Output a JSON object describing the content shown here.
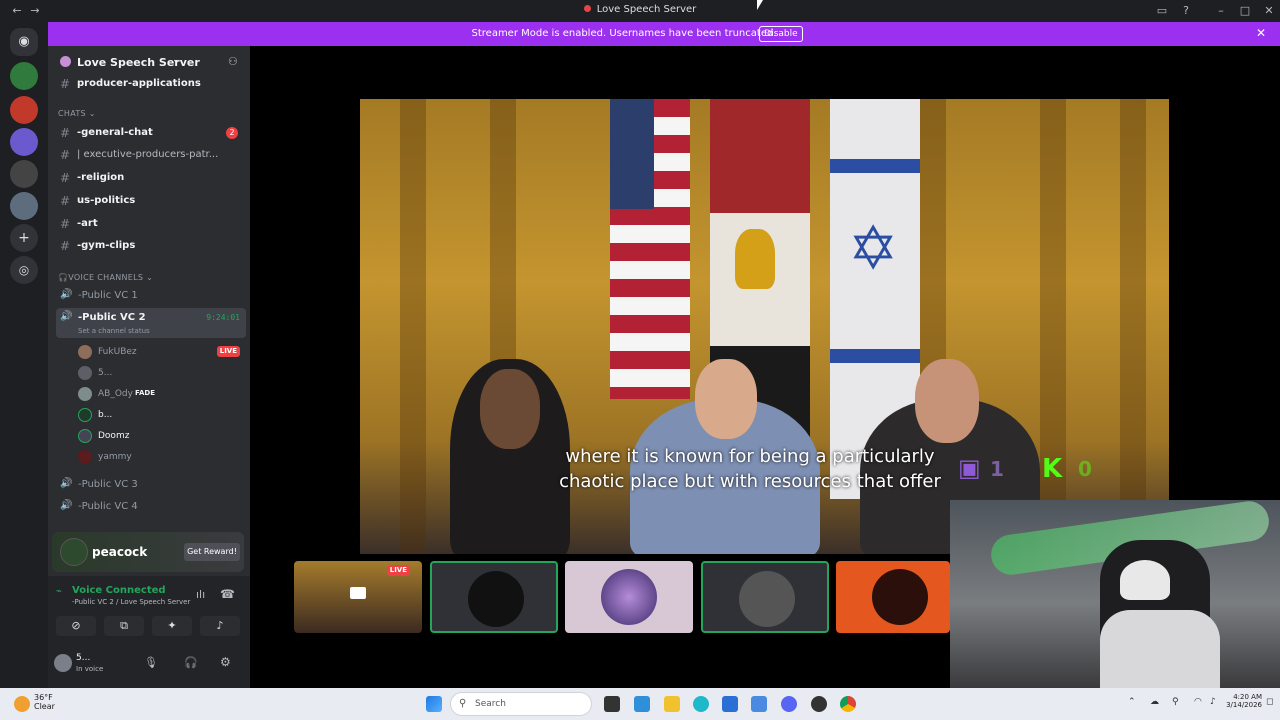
{
  "window": {
    "title": "Love Speech Server"
  },
  "banner": {
    "message": "Streamer Mode is enabled. Usernames have been truncated.",
    "disable_label": "Disable"
  },
  "server": {
    "name": "Love Speech Server"
  },
  "channels": {
    "top": "producer-applications",
    "chats_category": "CHATS",
    "items": [
      {
        "label": "-general-chat",
        "badge": "2"
      },
      {
        "label": "| executive-producers-patr..."
      },
      {
        "label": "-religion"
      },
      {
        "label": "us-politics"
      },
      {
        "label": "-art"
      },
      {
        "label": "-gym-clips"
      }
    ],
    "voice_category": "VOICE CHANNELS",
    "vc1": "-Public VC 1",
    "vc2": "-Public VC 2",
    "vc2_timer": "9:24:01",
    "vc2_status": "Set a channel status",
    "users": [
      {
        "name": "FukUBez",
        "live": "LIVE"
      },
      {
        "name": "5..."
      },
      {
        "name": "AB_Ody",
        "tag": "FADE"
      },
      {
        "name": "b..."
      },
      {
        "name": "Doomz"
      },
      {
        "name": "yammy"
      }
    ],
    "vc3": "-Public VC 3",
    "vc4": "-Public VC 4"
  },
  "promo": {
    "brand": "peacock",
    "button": "Get Reward!"
  },
  "voice": {
    "status": "Voice Connected",
    "location": "-Public VC 2 / Love Speech Server"
  },
  "user": {
    "name": "5...",
    "status": "In voice"
  },
  "stage": {
    "subtitle_line1": "where it is known for being a particularly",
    "subtitle_line2": "chaotic place but with resources that offer",
    "tile_live": "LIVE",
    "overlay_left": "1",
    "overlay_right": "0"
  },
  "taskbar": {
    "temp": "36°F",
    "condition": "Clear",
    "search_placeholder": "Search",
    "time": "4:20 AM",
    "date": "3/14/2026"
  },
  "colors": {
    "banner": "#9b30f0",
    "voice_green": "#23a55a",
    "live_red": "#ed4245"
  }
}
